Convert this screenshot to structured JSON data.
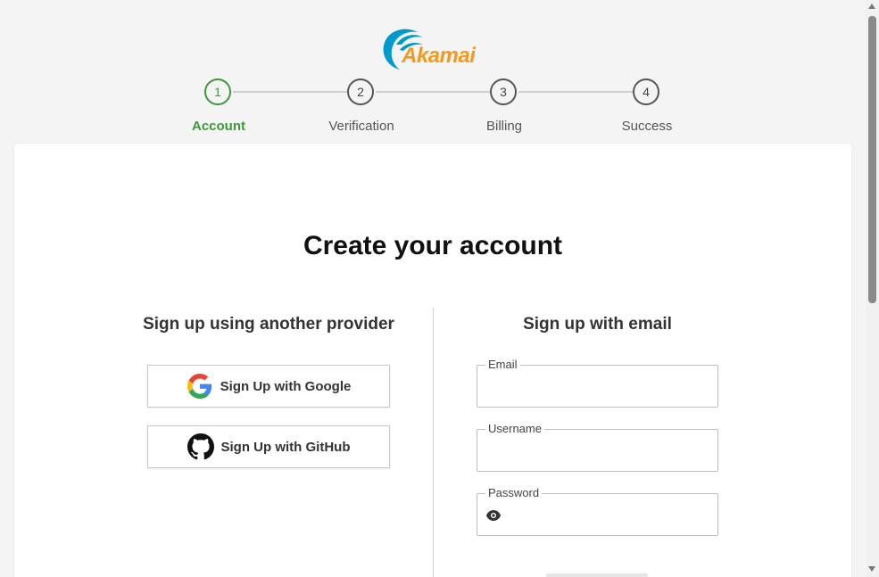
{
  "brand": {
    "name": "Akamai",
    "colors": {
      "orange": "#f39a1e",
      "blue": "#0099cc"
    }
  },
  "stepper": {
    "steps": [
      {
        "number": "1",
        "label": "Account",
        "active": true
      },
      {
        "number": "2",
        "label": "Verification",
        "active": false
      },
      {
        "number": "3",
        "label": "Billing",
        "active": false
      },
      {
        "number": "4",
        "label": "Success",
        "active": false
      }
    ],
    "active_color": "#3a9a3a"
  },
  "page": {
    "title": "Create your account"
  },
  "providers": {
    "title": "Sign up using another provider",
    "google_label": "Sign Up with Google",
    "github_label": "Sign Up with GitHub"
  },
  "email_signup": {
    "title": "Sign up with email",
    "email": {
      "label": "Email",
      "value": ""
    },
    "username": {
      "label": "Username",
      "value": ""
    },
    "password": {
      "label": "Password",
      "value": ""
    }
  }
}
